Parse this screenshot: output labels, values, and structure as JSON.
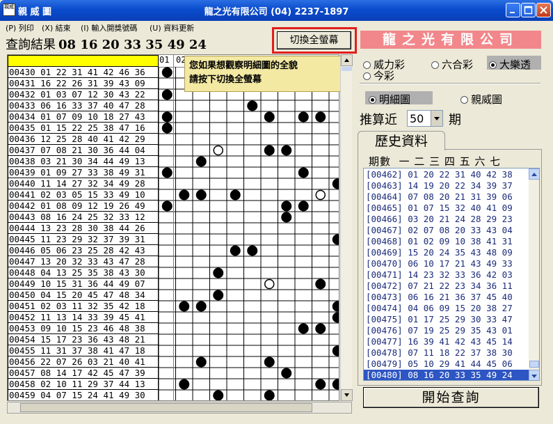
{
  "window": {
    "title": "親 威 圖",
    "company_title": "龍之光有限公司 (04) 2237-1897",
    "icon_text": "親威"
  },
  "menu": [
    {
      "label": "(P) 列印"
    },
    {
      "label": "(X) 結束"
    },
    {
      "label": "(I) 輸入開獎號碼"
    },
    {
      "label": "(U) 資料更新"
    }
  ],
  "result": {
    "label": "查詢結果",
    "numbers": "08 16 20 33 35 49 24"
  },
  "switch_button": {
    "label": "切換全螢幕"
  },
  "company_banner": "龍之光有限公司",
  "tooltip": {
    "line1": "您如果想觀察明細圖的全貌",
    "line2": "請按下切換全螢幕"
  },
  "grid": {
    "visible_columns": [
      "01",
      "02"
    ],
    "rows": [
      {
        "id": "00430",
        "nums": "01 22 31 41 42 46 36",
        "full": [
          1
        ],
        "hollow": []
      },
      {
        "id": "00431",
        "nums": "16 22 26 31 39 43 09",
        "full": [],
        "hollow": []
      },
      {
        "id": "00432",
        "nums": "01 03 07 12 30 43 22",
        "full": [
          1
        ],
        "hollow": []
      },
      {
        "id": "00433",
        "nums": "06 16 33 37 40 47 28",
        "full": [
          6
        ],
        "hollow": []
      },
      {
        "id": "00434",
        "nums": "01 07 09 10 18 27 43",
        "full": [
          1,
          7,
          9,
          10
        ],
        "hollow": []
      },
      {
        "id": "00435",
        "nums": "01 15 22 25 38 47 16",
        "full": [
          1
        ],
        "hollow": []
      },
      {
        "id": "00436",
        "nums": "12 25 28 40 41 42 29",
        "full": [],
        "hollow": []
      },
      {
        "id": "00437",
        "nums": "07 08 21 30 36 44 04",
        "full": [
          7,
          8
        ],
        "hollow": [
          4
        ]
      },
      {
        "id": "00438",
        "nums": "03 21 30 34 44 49 13",
        "full": [
          3
        ],
        "hollow": []
      },
      {
        "id": "00439",
        "nums": "01 09 27 33 38 49 31",
        "full": [
          1,
          9
        ],
        "hollow": []
      },
      {
        "id": "00440",
        "nums": "11 14 27 32 34 49 28",
        "full": [
          11
        ],
        "hollow": []
      },
      {
        "id": "00441",
        "nums": "02 03 05 15 33 49 10",
        "full": [
          2,
          3,
          5
        ],
        "hollow": [
          10
        ]
      },
      {
        "id": "00442",
        "nums": "01 08 09 12 19 26 49",
        "full": [
          1,
          8,
          9
        ],
        "hollow": []
      },
      {
        "id": "00443",
        "nums": "08 16 24 25 32 33 12",
        "full": [
          8
        ],
        "hollow": []
      },
      {
        "id": "00444",
        "nums": "13 23 28 30 38 44 26",
        "full": [],
        "hollow": []
      },
      {
        "id": "00445",
        "nums": "11 23 29 32 37 39 31",
        "full": [
          11
        ],
        "hollow": []
      },
      {
        "id": "00446",
        "nums": "05 06 23 25 28 42 43",
        "full": [
          5,
          6
        ],
        "hollow": []
      },
      {
        "id": "00447",
        "nums": "13 20 32 33 43 47 28",
        "full": [],
        "hollow": []
      },
      {
        "id": "00448",
        "nums": "04 13 25 35 38 43 30",
        "full": [
          4
        ],
        "hollow": []
      },
      {
        "id": "00449",
        "nums": "10 15 31 36 44 49 07",
        "full": [
          10
        ],
        "hollow": [
          7
        ]
      },
      {
        "id": "00450",
        "nums": "04 15 20 45 47 48 34",
        "full": [
          4
        ],
        "hollow": []
      },
      {
        "id": "00451",
        "nums": "02 03 11 32 35 42 18",
        "full": [
          2,
          3,
          11
        ],
        "hollow": []
      },
      {
        "id": "00452",
        "nums": "11 13 14 33 39 45 41",
        "full": [
          11
        ],
        "hollow": []
      },
      {
        "id": "00453",
        "nums": "09 10 15 23 46 48 38",
        "full": [
          9,
          10
        ],
        "hollow": []
      },
      {
        "id": "00454",
        "nums": "15 17 23 36 43 48 21",
        "full": [],
        "hollow": []
      },
      {
        "id": "00455",
        "nums": "11 31 37 38 41 47 18",
        "full": [
          11
        ],
        "hollow": []
      },
      {
        "id": "00456",
        "nums": "22 07 26 03 21 40 41",
        "full": [
          7,
          3
        ],
        "hollow": []
      },
      {
        "id": "00457",
        "nums": "08 14 17 42 45 47 39",
        "full": [
          8
        ],
        "hollow": []
      },
      {
        "id": "00458",
        "nums": "02 10 11 29 37 44 13",
        "full": [
          2,
          10,
          11
        ],
        "hollow": []
      },
      {
        "id": "00459",
        "nums": "04 07 15 24 41 49 30",
        "full": [
          4,
          7
        ],
        "hollow": []
      }
    ]
  },
  "lottery_types": [
    {
      "label": "威力彩",
      "selected": false
    },
    {
      "label": "六合彩",
      "selected": false
    },
    {
      "label": "大樂透",
      "selected": true
    },
    {
      "label": "今彩",
      "selected": false
    }
  ],
  "chart_modes": [
    {
      "label": "明細圖",
      "selected": true
    },
    {
      "label": "親威圖",
      "selected": false
    }
  ],
  "calc": {
    "label": "推算近",
    "value": "50",
    "unit": "期"
  },
  "history": {
    "tab_label": "歷史資料",
    "header": "期數  一 二 三 四 五 六 七",
    "rows": [
      "[00462] 01 20 22 31 40 42 38",
      "[00463] 14 19 20 22 34 39 37",
      "[00464] 07 08 20 21 31 39 06",
      "[00465] 01 07 15 32 40 41 09",
      "[00466] 03 20 21 24 28 29 23",
      "[00467] 02 07 08 20 33 43 04",
      "[00468] 01 02 09 10 38 41 31",
      "[00469] 15 20 24 35 43 48 09",
      "[00470] 06 10 17 21 43 49 33",
      "[00471] 14 23 32 33 36 42 03",
      "[00472] 07 21 22 23 34 36 11",
      "[00473] 06 16 21 36 37 45 40",
      "[00474] 04 06 09 15 20 38 27",
      "[00475] 01 17 25 29 30 33 47",
      "[00476] 07 19 25 29 35 43 01",
      "[00477] 16 39 41 42 43 45 14",
      "[00478] 07 11 18 22 37 38 30",
      "[00479] 05 10 29 41 44 45 06",
      "[00480] 08 16 20 33 35 49 24"
    ],
    "selected_index": 18
  },
  "start_button": {
    "label": "開始查詢"
  }
}
